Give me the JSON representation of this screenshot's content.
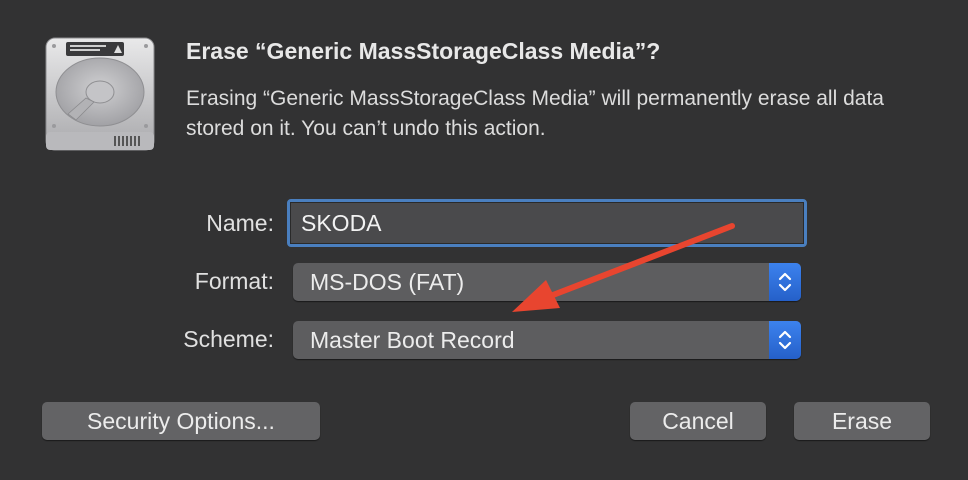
{
  "dialog": {
    "title": "Erase “Generic MassStorageClass Media”?",
    "message": "Erasing “Generic MassStorageClass Media” will permanently erase all data stored on it. You can’t undo this action."
  },
  "form": {
    "name_label": "Name:",
    "name_value": "SKODA",
    "format_label": "Format:",
    "format_value": "MS-DOS (FAT)",
    "scheme_label": "Scheme:",
    "scheme_value": "Master Boot Record"
  },
  "buttons": {
    "security_options": "Security Options...",
    "cancel": "Cancel",
    "erase": "Erase"
  },
  "icons": {
    "disk": "hard-disk-icon",
    "stepper": "up-down-chevron-icon",
    "annotation": "red-arrow-annotation"
  },
  "colors": {
    "background": "#323233",
    "accent": "#2f6fd6",
    "focus_ring": "#4a7fbf",
    "annotation": "#e8452f"
  }
}
